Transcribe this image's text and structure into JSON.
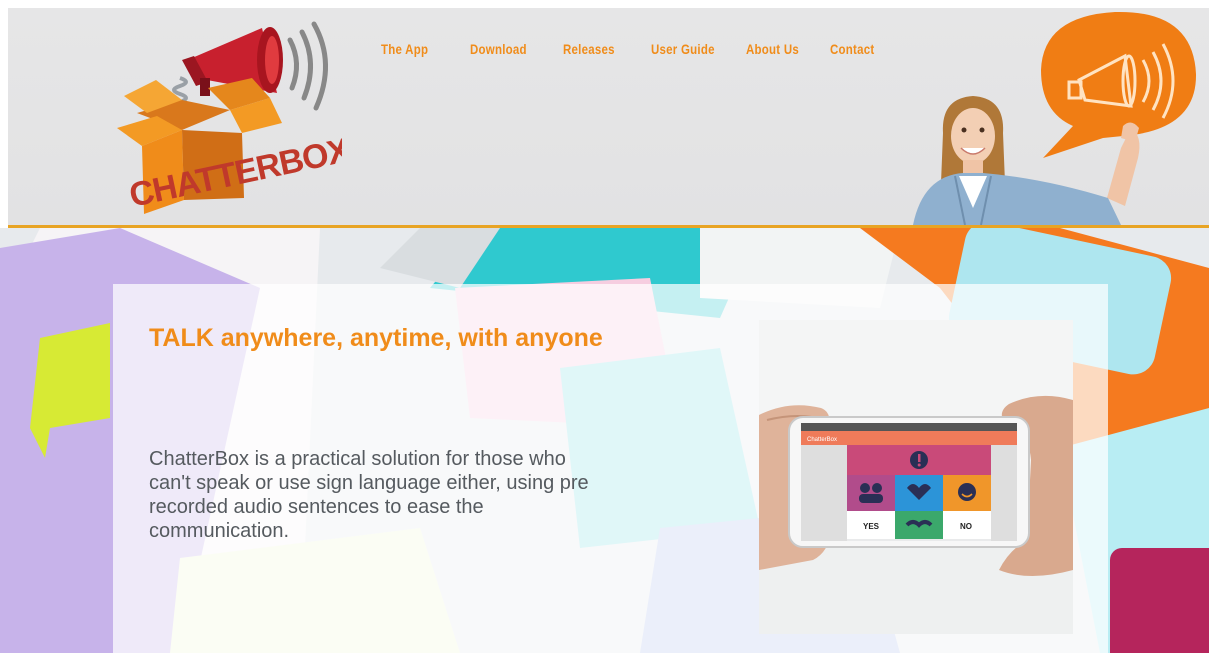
{
  "brand": {
    "logo_text": "CHATTERBOX"
  },
  "nav": {
    "items": [
      {
        "label": "The App"
      },
      {
        "label": "Download"
      },
      {
        "label": "Releases"
      },
      {
        "label": "User Guide"
      },
      {
        "label": "About Us"
      },
      {
        "label": "Contact"
      }
    ]
  },
  "hero": {
    "headline": "TALK anywhere, anytime, with anyone",
    "description": "ChatterBox is a practical solution for those who can't speak or use sign language either, using pre recorded audio sentences to ease the communication."
  },
  "phone_screen": {
    "app_title": "ChatterBox",
    "yes_label": "YES",
    "no_label": "NO"
  },
  "colors": {
    "accent": "#f08c1a",
    "header_bg": "#e4e4e5",
    "header_border": "#e8a424",
    "body_text": "#555a5f"
  },
  "icons": {
    "logo": "megaphone-box-icon",
    "speech_bubble": "megaphone-speech-bubble-icon"
  }
}
